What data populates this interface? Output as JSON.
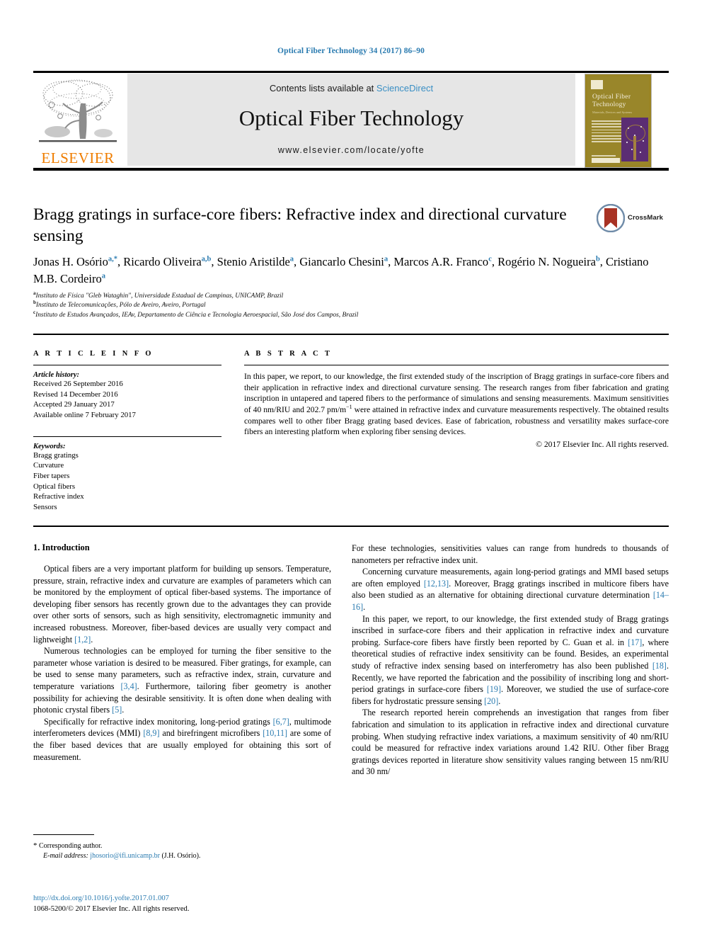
{
  "running_head": "Optical Fiber Technology 34 (2017) 86–90",
  "masthead": {
    "contents_prefix": "Contents lists available at ",
    "sciencedirect": "ScienceDirect",
    "journal_name": "Optical Fiber Technology",
    "journal_url": "www.elsevier.com/locate/yofte",
    "publisher_word": "ELSEVIER",
    "cover": {
      "title": "Optical Fiber Technology",
      "subtitle": "Materials, Devices and Systems"
    }
  },
  "article": {
    "title": "Bragg gratings in surface-core fibers: Refractive index and directional curvature sensing",
    "crossmark_label": "CrossMark",
    "authors_line1": "Jonas H. Osório",
    "authors_html_line1_sup": "a,*",
    "authors": [
      {
        "name": "Jonas H. Osório",
        "sup": "a,*"
      },
      {
        "name": "Ricardo Oliveira",
        "sup": "a,b"
      },
      {
        "name": "Stenio Aristilde",
        "sup": "a"
      },
      {
        "name": "Giancarlo Chesini",
        "sup": "a"
      },
      {
        "name": "Marcos A.R. Franco",
        "sup": "c"
      },
      {
        "name": "Rogério N. Nogueira",
        "sup": "b"
      },
      {
        "name": "Cristiano M.B. Cordeiro",
        "sup": "a"
      }
    ],
    "affiliations": [
      {
        "sup": "a",
        "text": "Instituto de Física \"Gleb Wataghin\", Universidade Estadual de Campinas, UNICAMP, Brazil"
      },
      {
        "sup": "b",
        "text": "Instituto de Telecomunicações, Pólo de Aveiro, Aveiro, Portugal"
      },
      {
        "sup": "c",
        "text": "Instituto de Estudos Avançados, IEAv, Departamento de Ciência e Tecnologia Aeroespacial, São José dos Campos, Brazil"
      }
    ]
  },
  "article_info": {
    "heading": "A R T I C L E   I N F O",
    "history_label": "Article history:",
    "history": [
      "Received 26 September 2016",
      "Revised 14 December 2016",
      "Accepted 29 January 2017",
      "Available online 7 February 2017"
    ],
    "keywords_label": "Keywords:",
    "keywords": [
      "Bragg gratings",
      "Curvature",
      "Fiber tapers",
      "Optical fibers",
      "Refractive index",
      "Sensors"
    ]
  },
  "abstract": {
    "heading": "A B S T R A C T",
    "text_part1": "In this paper, we report, to our knowledge, the first extended study of the inscription of Bragg gratings in surface-core fibers and their application in refractive index and directional curvature sensing. The research ranges from fiber fabrication and grating inscription in untapered and tapered fibers to the performance of simulations and sensing measurements. Maximum sensitivities of 40 nm/RIU and 202.7 pm/m",
    "superscript": "−1",
    "text_part2": " were attained in refractive index and curvature measurements respectively. The obtained results compares well to other fiber Bragg grating based devices. Ease of fabrication, robustness and versatility makes surface-core fibers an interesting platform when exploring fiber sensing devices.",
    "rights": "© 2017 Elsevier Inc. All rights reserved."
  },
  "body": {
    "section1_title": "1. Introduction",
    "left_paragraphs": [
      "Optical fibers are a very important platform for building up sensors. Temperature, pressure, strain, refractive index and curvature are examples of parameters which can be monitored by the employment of optical fiber-based systems. The importance of developing fiber sensors has recently grown due to the advantages they can provide over other sorts of sensors, such as high sensitivity, electromagnetic immunity and increased robustness. Moreover, fiber-based devices are usually very compact and lightweight [1,2].",
      "Numerous technologies can be employed for turning the fiber sensitive to the parameter whose variation is desired to be measured. Fiber gratings, for example, can be used to sense many parameters, such as refractive index, strain, curvature and temperature variations [3,4]. Furthermore, tailoring fiber geometry is another possibility for achieving the desirable sensitivity. It is often done when dealing with photonic crystal fibers [5].",
      "Specifically for refractive index monitoring, long-period gratings [6,7], multimode interferometers devices (MMI) [8,9] and birefringent microfibers [10,11] are some of the fiber based devices that are usually employed for obtaining this sort of measurement."
    ],
    "right_paragraphs": [
      "For these technologies, sensitivities values can range from hundreds to thousands of nanometers per refractive index unit.",
      "Concerning curvature measurements, again long-period gratings and MMI based setups are often employed [12,13]. Moreover, Bragg gratings inscribed in multicore fibers have also been studied as an alternative for obtaining directional curvature determination [14–16].",
      "In this paper, we report, to our knowledge, the first extended study of Bragg gratings inscribed in surface-core fibers and their application in refractive index and curvature probing. Surface-core fibers have firstly been reported by C. Guan et al. in [17], where theoretical studies of refractive index sensitivity can be found. Besides, an experimental study of refractive index sensing based on interferometry has also been published [18]. Recently, we have reported the fabrication and the possibility of inscribing long and short-period gratings in surface-core fibers [19]. Moreover, we studied the use of surface-core fibers for hydrostatic pressure sensing [20].",
      "The research reported herein comprehends an investigation that ranges from fiber fabrication and simulation to its application in refractive index and directional curvature probing. When studying refractive index variations, a maximum sensitivity of 40 nm/RIU could be measured for refractive index variations around 1.42 RIU. Other fiber Bragg gratings devices reported in literature show sensitivity values ranging between 15 nm/RIU and 30 nm/"
    ]
  },
  "footnote": {
    "corresponding": "Corresponding author.",
    "email_label": "E-mail address:",
    "email": "jhosorio@ifi.unicamp.br",
    "email_owner": "(J.H. Osório)."
  },
  "footer": {
    "doi": "http://dx.doi.org/10.1016/j.yofte.2017.01.007",
    "issn_rights": "1068-5200/© 2017 Elsevier Inc. All rights reserved."
  },
  "colors": {
    "link": "#2a7bb0",
    "sciencedirect": "#3a8fc4",
    "elsevier_orange": "#ef7d00",
    "masthead_bg": "#e6e6e6",
    "cover_olive": "#99862a",
    "cover_purple": "#5b2d73",
    "crossmark_red": "#a83224",
    "crossmark_blue": "#6f8ba8"
  }
}
